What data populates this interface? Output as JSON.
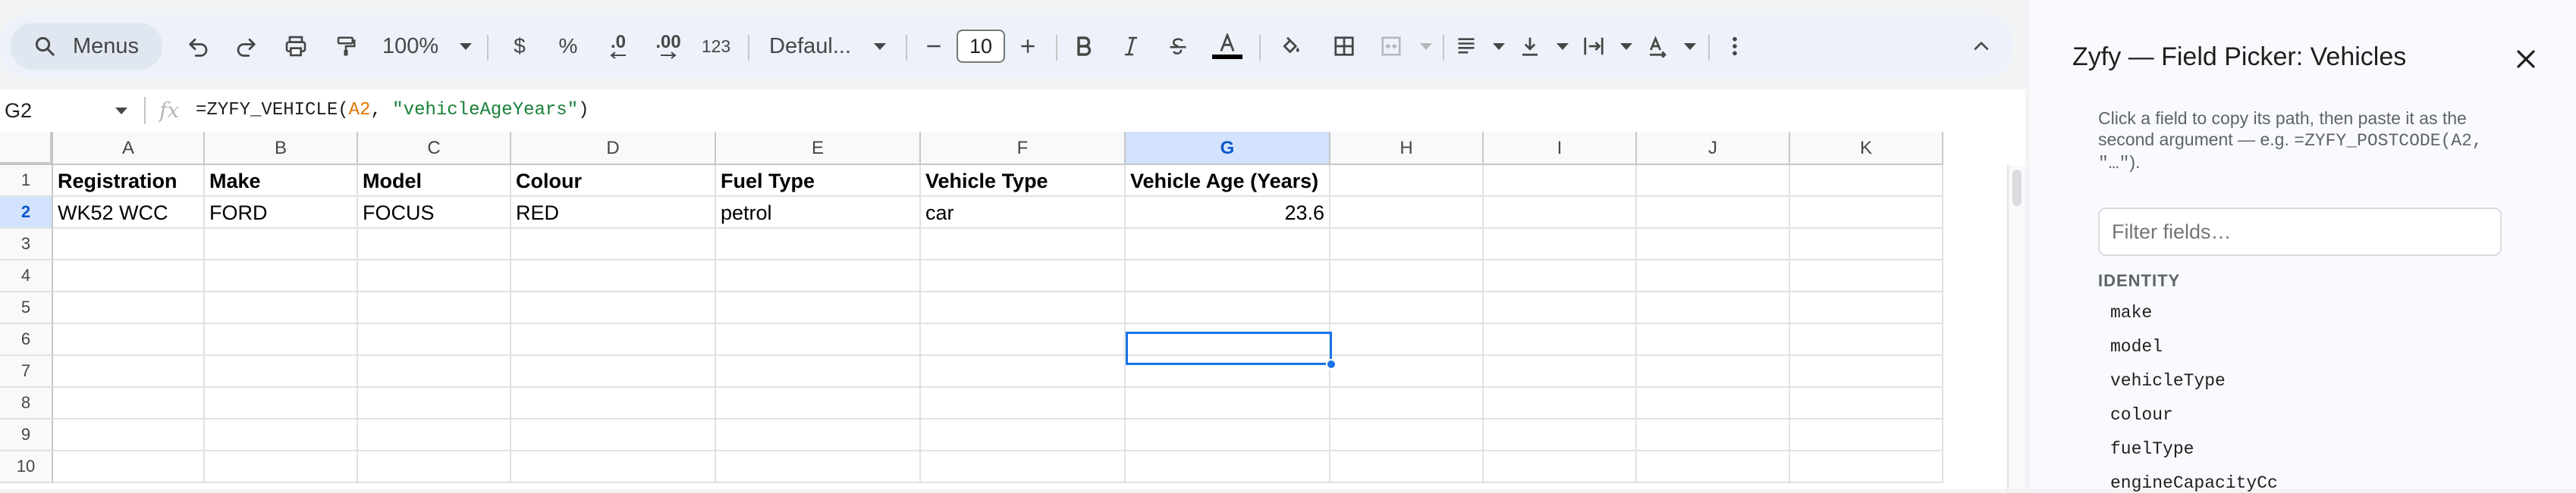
{
  "toolbar": {
    "menus_label": "Menus",
    "zoom": "100%",
    "currency": "$",
    "percent": "%",
    "decrease_decimal": ".0",
    "increase_decimal": ".00",
    "number_format": "123",
    "font": "Defaul...",
    "font_size": "10"
  },
  "formula_bar": {
    "name_box": "G2",
    "fx": "fx",
    "formula_prefix": "=ZYFY_VEHICLE(",
    "formula_ref": "A2",
    "formula_sep": ", ",
    "formula_string": "\"vehicleAgeYears\"",
    "formula_suffix": ")"
  },
  "grid": {
    "columns": [
      "A",
      "B",
      "C",
      "D",
      "E",
      "F",
      "G",
      "H",
      "I",
      "J",
      "K"
    ],
    "row_numbers": [
      "1",
      "2",
      "3",
      "4",
      "5",
      "6",
      "7",
      "8",
      "9",
      "10"
    ],
    "header_row": [
      "Registration",
      "Make",
      "Model",
      "Colour",
      "Fuel Type",
      "Vehicle Type",
      "Vehicle Age (Years)"
    ],
    "data_row": [
      "WK52 WCC",
      "FORD",
      "FOCUS",
      "RED",
      "petrol",
      "car",
      "23.6"
    ],
    "selected_cell": "G2"
  },
  "panel": {
    "title": "Zyfy — Field Picker: Vehicles",
    "hint_line1": "Click a field to copy its path, then paste it as the",
    "hint_line2_text": "second argument — e.g. ",
    "hint_line2_code": "=ZYFY_POSTCODE(A2,",
    "hint_line3_code": "\"…\"",
    "hint_line3_end": ").",
    "filter_placeholder": "Filter fields…",
    "section": "IDENTITY",
    "fields": [
      "make",
      "model",
      "vehicleType",
      "colour",
      "fuelType",
      "engineCapacityCc"
    ]
  },
  "colors": {
    "accent": "#0b57d0",
    "selection_fill": "#d3e3fd",
    "formula_ref": "#e37400",
    "formula_string": "#188038"
  }
}
